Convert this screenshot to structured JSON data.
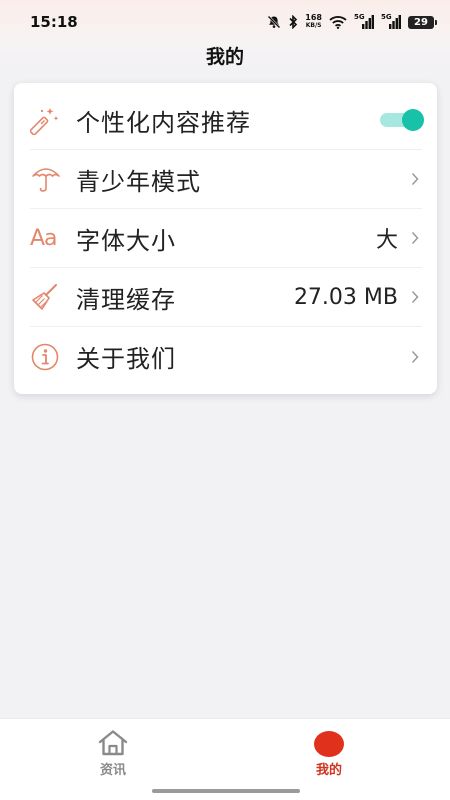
{
  "status_bar": {
    "time": "15:18",
    "net_speed_value": "168",
    "net_speed_unit": "KB/S",
    "sim1_tag": "5G",
    "sim2_tag": "5G",
    "battery": "29"
  },
  "header": {
    "title": "我的"
  },
  "settings": {
    "items": [
      {
        "label": "个性化内容推荐",
        "icon": "magic-wand-icon",
        "control": "toggle",
        "toggle_on": true
      },
      {
        "label": "青少年模式",
        "icon": "umbrella-icon",
        "control": "chevron"
      },
      {
        "label": "字体大小",
        "icon": "font-aa-icon",
        "icon_text": "Aa",
        "value": "大",
        "control": "chevron"
      },
      {
        "label": "清理缓存",
        "icon": "broom-icon",
        "value": "27.03 MB",
        "control": "chevron"
      },
      {
        "label": "关于我们",
        "icon": "info-icon",
        "control": "chevron"
      }
    ]
  },
  "tab_bar": {
    "tabs": [
      {
        "label": "资讯",
        "icon": "home-icon",
        "active": false
      },
      {
        "label": "我的",
        "icon": "profile-dot-icon",
        "active": true
      }
    ]
  },
  "colors": {
    "accent": "#e0311c",
    "icon_orange": "#e4866b",
    "toggle_on": "#18c2a8",
    "background": "#f2f2f5"
  }
}
